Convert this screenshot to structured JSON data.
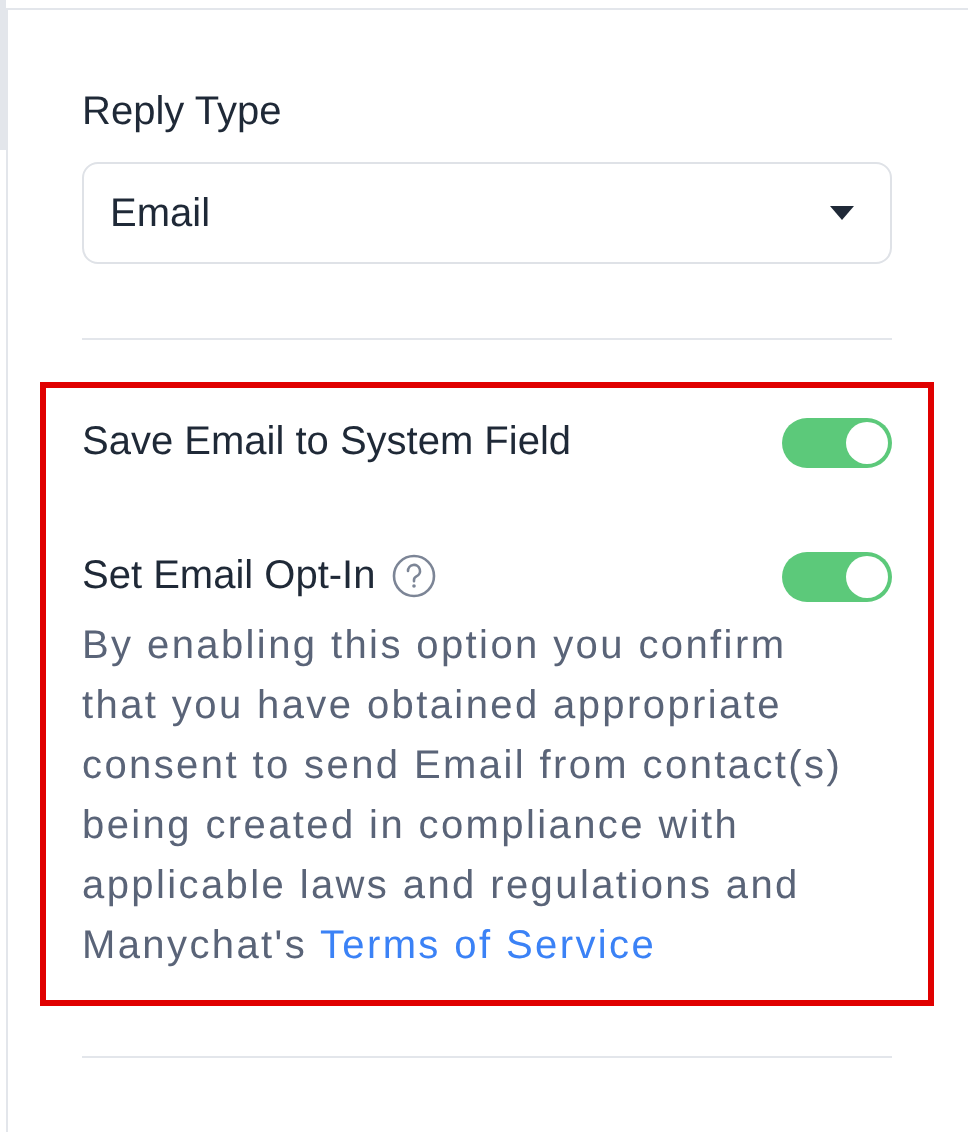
{
  "reply_type": {
    "label": "Reply Type",
    "value": "Email"
  },
  "options": [
    {
      "label": "Save Email to System Field",
      "on": true,
      "help": false
    },
    {
      "label": "Set Email Opt-In",
      "on": true,
      "help": true
    }
  ],
  "description": {
    "text": "By enabling this option you confirm that you have obtained appropriate consent to send Email from contact(s) being created in compliance with applicable laws and regulations and Manychat's",
    "link": "Terms of Service"
  },
  "highlighted": true
}
